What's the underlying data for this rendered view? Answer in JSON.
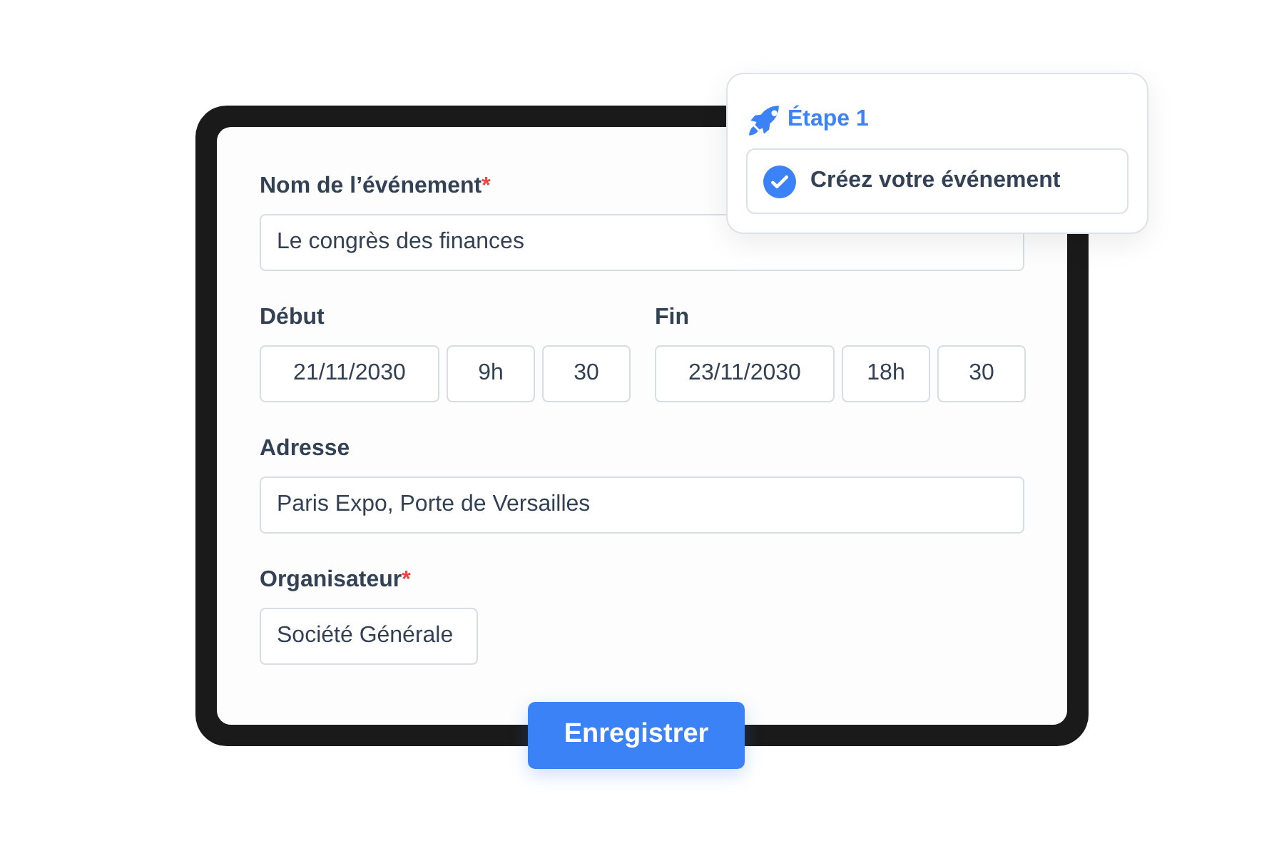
{
  "event_name": {
    "label": "Nom de l’événement",
    "required_mark": "*",
    "value": "Le congrès des finances"
  },
  "start": {
    "label": "Début",
    "date": "21/11/2030",
    "hour": "9h",
    "minute": "30"
  },
  "end": {
    "label": "Fin",
    "date": "23/11/2030",
    "hour": "18h",
    "minute": "30"
  },
  "address": {
    "label": "Adresse",
    "value": "Paris Expo, Porte de Versailles"
  },
  "organizer": {
    "label": "Organisateur",
    "required_mark": "*",
    "value": "Société Générale"
  },
  "save_button": "Enregistrer",
  "step_popover": {
    "title": "Étape 1",
    "step": {
      "label": "Créez votre événement",
      "done": true
    }
  }
}
